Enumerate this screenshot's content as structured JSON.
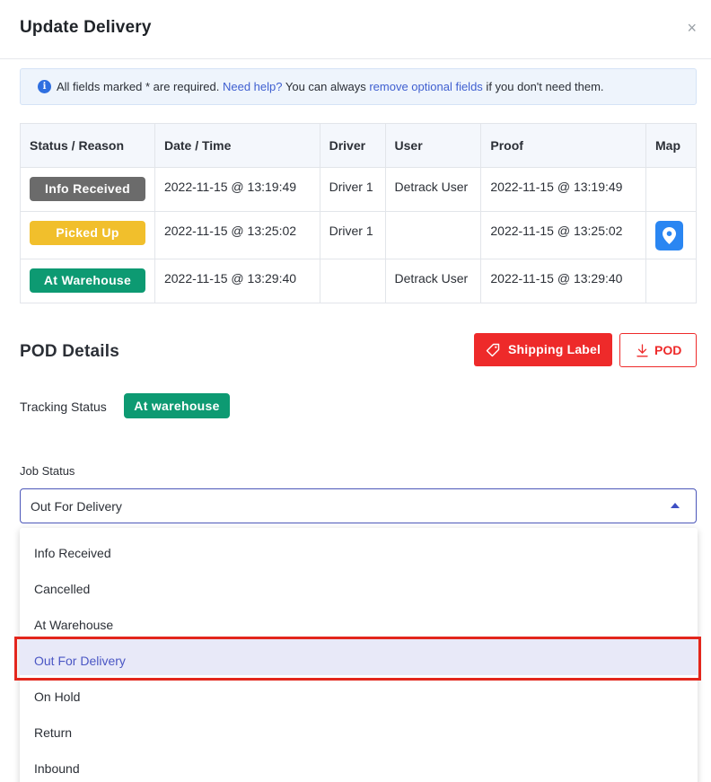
{
  "modal": {
    "title": "Update Delivery",
    "close_glyph": "×"
  },
  "banner": {
    "text_before": "All fields marked * are required. ",
    "help_link": "Need help?",
    "text_middle": " You can always ",
    "optional_link": "remove optional fields",
    "text_after": " if you don't need them."
  },
  "history": {
    "headers": [
      "Status / Reason",
      "Date / Time",
      "Driver",
      "User",
      "Proof",
      "Map"
    ],
    "rows": [
      {
        "status": "Info Received",
        "status_color": "#6b6b6b",
        "datetime": "2022-11-15 @ 13:19:49",
        "driver": "Driver 1",
        "user": "Detrack User",
        "proof": "2022-11-15 @ 13:19:49",
        "map": false
      },
      {
        "status": "Picked Up",
        "status_color": "#f1bf2c",
        "datetime": "2022-11-15 @ 13:25:02",
        "driver": "Driver 1",
        "user": "",
        "proof": "2022-11-15 @ 13:25:02",
        "map": true
      },
      {
        "status": "At Warehouse",
        "status_color": "#0d9a72",
        "datetime": "2022-11-15 @ 13:29:40",
        "driver": "",
        "user": "Detrack User",
        "proof": "2022-11-15 @ 13:29:40",
        "map": false
      }
    ]
  },
  "pod": {
    "title": "POD Details",
    "shipping_label_button": "Shipping Label",
    "pod_button": "POD",
    "tracking_label": "Tracking Status",
    "tracking_value": "At warehouse"
  },
  "job_status": {
    "label": "Job Status",
    "selected": "Out For Delivery",
    "options": [
      "Info Received",
      "Cancelled",
      "At Warehouse",
      "Out For Delivery",
      "On Hold",
      "Return",
      "Inbound"
    ],
    "highlighted_index": 3
  },
  "colors": {
    "accent_red": "#ee2a2a",
    "accent_blue": "#4c57b9",
    "highlight_box": "#e3261c",
    "map_pin": "#2a86f2"
  }
}
